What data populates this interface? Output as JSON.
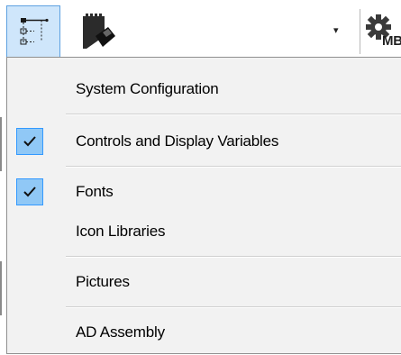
{
  "toolbar": {
    "tree_button_icon": "tree-structure-icon",
    "combo_icon": "sd-card-icon",
    "combo_arrow": "▾",
    "settings_icon": "gear-icon",
    "settings_badge": "MB"
  },
  "menu": {
    "items": [
      {
        "label": "System Configuration",
        "checked": false
      },
      {
        "label": "Controls and Display Variables",
        "checked": true
      },
      {
        "label": "Fonts",
        "checked": true
      },
      {
        "label": "Icon Libraries",
        "checked": false
      },
      {
        "label": "Pictures",
        "checked": false
      },
      {
        "label": "AD Assembly",
        "checked": false
      }
    ]
  },
  "colors": {
    "highlight_fill": "#cfe6fb",
    "highlight_border": "#5ea1e1",
    "check_fill": "#90c8f6",
    "check_border": "#3399ff",
    "menu_background": "#f2f2f2"
  }
}
